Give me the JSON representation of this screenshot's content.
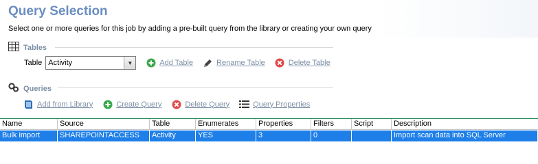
{
  "header": {
    "title": "Query Selection",
    "subtitle": "Select one or more queries for this job by adding a pre-built query from the library or creating your own query"
  },
  "tables_section": {
    "title": "Tables",
    "table_label": "Table",
    "selected_table": "Activity",
    "actions": {
      "add": "Add Table",
      "rename": "Rename Table",
      "delete": "Delete Table"
    }
  },
  "queries_section": {
    "title": "Queries",
    "actions": {
      "add_from_library": "Add from Library",
      "create": "Create Query",
      "delete": "Delete Query",
      "properties": "Query Properties"
    }
  },
  "grid": {
    "columns": [
      "Name",
      "Source",
      "Table",
      "Enumerates",
      "Properties",
      "Filters",
      "Script",
      "Description"
    ],
    "rows": [
      [
        "Bulk import",
        "SHAREPOINTACCESS",
        "Activity",
        "YES",
        "3",
        "0",
        "",
        "Import scan data into SQL Server"
      ]
    ]
  },
  "colors": {
    "title": "#6a8ec2",
    "section_label": "#7d8fa6",
    "selection": "#1e7fe8",
    "add_green": "#3aa84a",
    "delete_red": "#e04a4a"
  }
}
